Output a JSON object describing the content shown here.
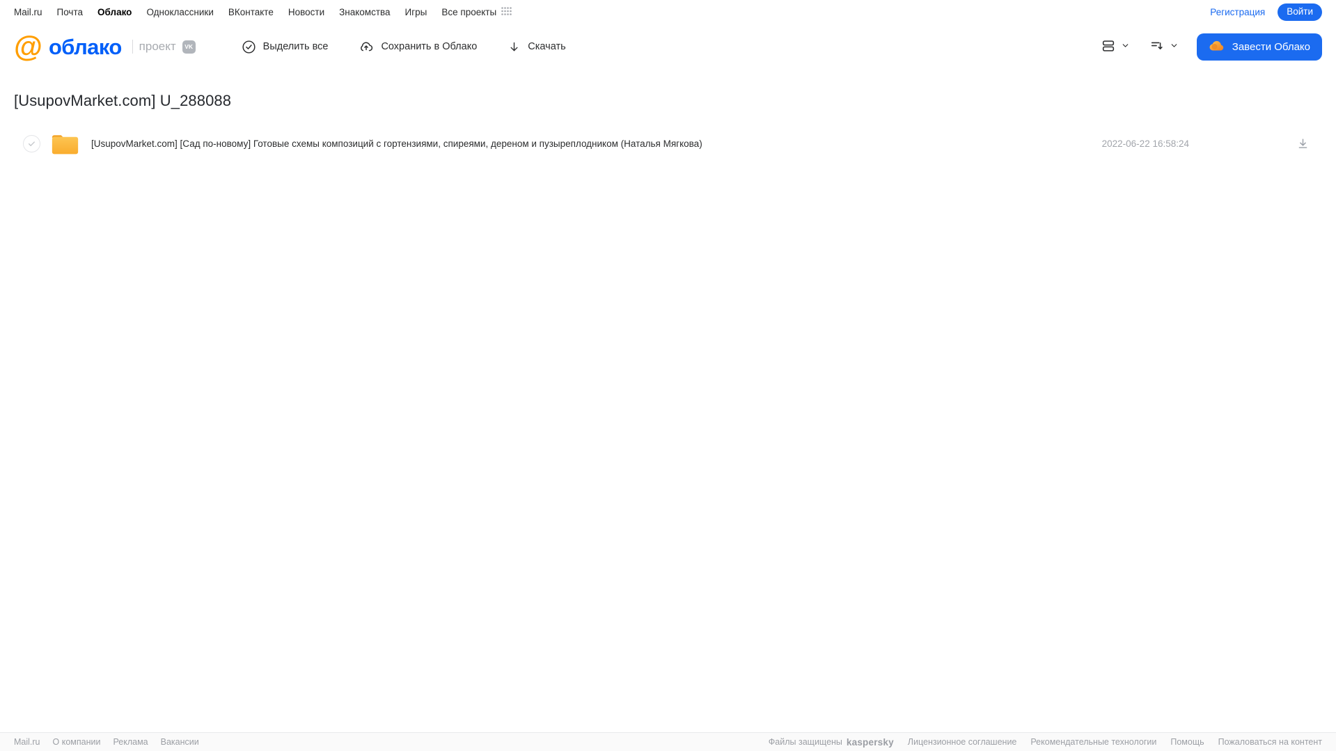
{
  "topnav": {
    "items": [
      {
        "label": "Mail.ru"
      },
      {
        "label": "Почта"
      },
      {
        "label": "Облако"
      },
      {
        "label": "Одноклассники"
      },
      {
        "label": "ВКонтакте"
      },
      {
        "label": "Новости"
      },
      {
        "label": "Знакомства"
      },
      {
        "label": "Игры"
      },
      {
        "label": "Все проекты"
      }
    ],
    "registration": "Регистрация",
    "login": "Войти"
  },
  "header": {
    "logo_text": "облако",
    "project_label": "проект",
    "vk_badge": "VK",
    "toolbar": {
      "select_all": "Выделить все",
      "save_to_cloud": "Сохранить в Облако",
      "download": "Скачать"
    },
    "get_cloud_button": "Завести Облако"
  },
  "main": {
    "title": "[UsupovMarket.com] U_288088",
    "files": [
      {
        "name": "[UsupovMarket.com] [Сад по-новому] Готовые схемы композиций с гортензиями, спиреями, дереном и пузыреплодником (Наталья Мягкова)",
        "modified": "2022-06-22 16:58:24"
      }
    ]
  },
  "footer": {
    "links_left": [
      "Mail.ru",
      "О компании",
      "Реклама",
      "Вакансии"
    ],
    "protected_by": "Файлы защищены",
    "kaspersky_logo": "kaspersky",
    "links_right": [
      "Лицензионное соглашение",
      "Рекомендательные технологии",
      "Помощь",
      "Пожаловаться на контент"
    ]
  },
  "colors": {
    "accent_blue": "#1b6bf0",
    "logo_orange": "#ff9e00",
    "logo_blue": "#005ff9",
    "kaspersky_green": "#00a88e",
    "folder_yellow": "#fbb336"
  }
}
